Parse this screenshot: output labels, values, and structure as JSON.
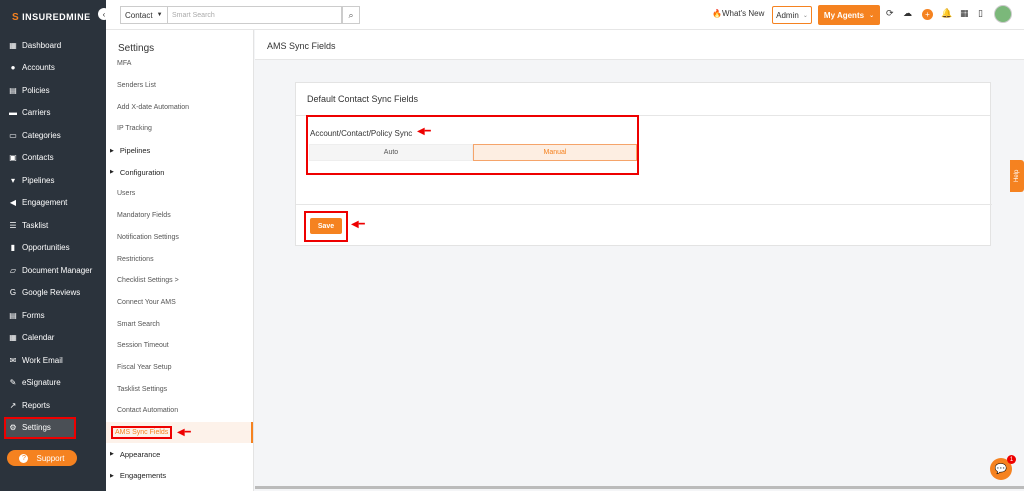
{
  "brand": {
    "name": "INSUREDMINE",
    "accent": "#f58220"
  },
  "nav": {
    "items": [
      {
        "label": "Dashboard",
        "icon": "dashboard-icon"
      },
      {
        "label": "Accounts",
        "icon": "user-icon"
      },
      {
        "label": "Policies",
        "icon": "policy-icon"
      },
      {
        "label": "Carriers",
        "icon": "truck-icon"
      },
      {
        "label": "Categories",
        "icon": "folder-icon"
      },
      {
        "label": "Contacts",
        "icon": "contact-card-icon"
      },
      {
        "label": "Pipelines",
        "icon": "funnel-icon"
      },
      {
        "label": "Engagement",
        "icon": "megaphone-icon"
      },
      {
        "label": "Tasklist",
        "icon": "list-icon"
      },
      {
        "label": "Opportunities",
        "icon": "bar-chart-icon"
      },
      {
        "label": "Document Manager",
        "icon": "folder-open-icon"
      },
      {
        "label": "Google Reviews",
        "icon": "google-icon"
      },
      {
        "label": "Forms",
        "icon": "form-icon"
      },
      {
        "label": "Calendar",
        "icon": "calendar-icon"
      },
      {
        "label": "Work Email",
        "icon": "mail-icon"
      },
      {
        "label": "eSignature",
        "icon": "signature-icon"
      },
      {
        "label": "Reports",
        "icon": "chart-line-icon"
      },
      {
        "label": "Settings",
        "icon": "gear-icon"
      }
    ],
    "support_label": "Support"
  },
  "topbar": {
    "search_scope": "Contact",
    "search_placeholder": "Smart Search",
    "whats_new": "What's New",
    "admin": "Admin",
    "my_agents": "My Agents"
  },
  "settings": {
    "title": "Settings",
    "items": [
      {
        "label": "MFA",
        "type": "item"
      },
      {
        "label": "Senders List",
        "type": "item"
      },
      {
        "label": "Add X-date Automation",
        "type": "item"
      },
      {
        "label": "IP Tracking",
        "type": "item"
      },
      {
        "label": "Pipelines",
        "type": "group"
      },
      {
        "label": "Configuration",
        "type": "group"
      },
      {
        "label": "Users",
        "type": "item"
      },
      {
        "label": "Mandatory Fields",
        "type": "item"
      },
      {
        "label": "Notification Settings",
        "type": "item"
      },
      {
        "label": "Restrictions",
        "type": "item"
      },
      {
        "label": "Checklist Settings  >",
        "type": "item"
      },
      {
        "label": "Connect Your AMS",
        "type": "item"
      },
      {
        "label": "Smart Search",
        "type": "item"
      },
      {
        "label": "Session Timeout",
        "type": "item"
      },
      {
        "label": "Fiscal Year Setup",
        "type": "item"
      },
      {
        "label": "Tasklist Settings",
        "type": "item"
      },
      {
        "label": "Contact Automation",
        "type": "item"
      },
      {
        "label": "AMS Sync Fields",
        "type": "active"
      },
      {
        "label": "Appearance",
        "type": "group"
      },
      {
        "label": "Engagements",
        "type": "group"
      }
    ]
  },
  "main": {
    "page_title": "AMS Sync Fields",
    "card_title": "Default Contact Sync Fields",
    "sync_label": "Account/Contact/Policy Sync",
    "options": [
      "Auto",
      "Manual"
    ],
    "selected": "Manual",
    "save_label": "Save"
  },
  "help_label": "Help",
  "chat_badge": "1"
}
